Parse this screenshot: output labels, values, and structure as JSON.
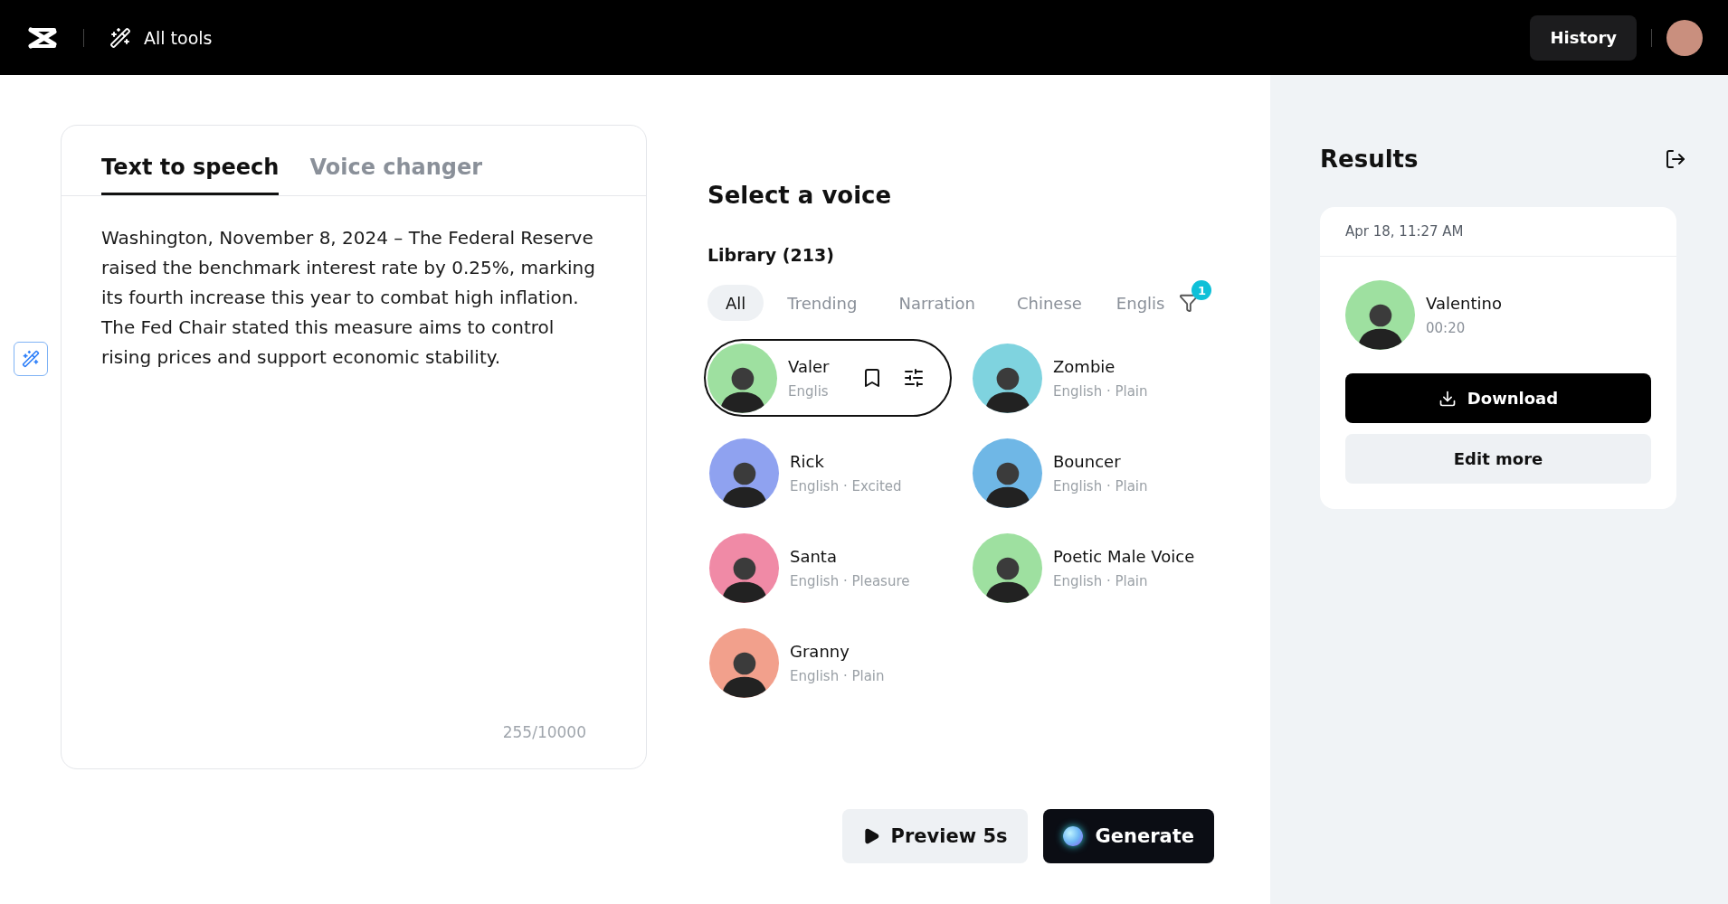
{
  "top_bar": {
    "all_tools": "All tools",
    "history": "History"
  },
  "editor": {
    "tabs": [
      {
        "label": "Text to speech",
        "selected": true
      },
      {
        "label": "Voice changer",
        "selected": false
      }
    ],
    "text": "Washington, November 8, 2024 – The Federal Reserve raised the benchmark interest rate by 0.25%, marking its fourth increase this year to combat high inflation. The Fed Chair stated this measure aims to control rising prices and support economic stability.",
    "counter": "255/10000"
  },
  "voices": {
    "title": "Select a voice",
    "library": "Library (213)",
    "filters": [
      {
        "label": "All",
        "selected": true
      },
      {
        "label": "Trending",
        "selected": false
      },
      {
        "label": "Narration",
        "selected": false
      },
      {
        "label": "Chinese",
        "selected": false
      },
      {
        "label": "Englis",
        "selected": false
      }
    ],
    "filter_badge": "1",
    "items": [
      {
        "name": "Valer",
        "meta": "Englis",
        "selected": true,
        "color": "#9ee0a0"
      },
      {
        "name": "Zombie",
        "meta": "English · Plain",
        "selected": false,
        "color": "#7fd3df"
      },
      {
        "name": "Rick",
        "meta": "English · Excited",
        "selected": false,
        "color": "#8fa2f0"
      },
      {
        "name": "Bouncer",
        "meta": "English · Plain",
        "selected": false,
        "color": "#6fb7e6"
      },
      {
        "name": "Santa",
        "meta": "English · Pleasure",
        "selected": false,
        "color": "#f08aa6"
      },
      {
        "name": "Poetic Male Voice",
        "meta": "English · Plain",
        "selected": false,
        "color": "#9ee0a0"
      },
      {
        "name": "Granny",
        "meta": "English · Plain",
        "selected": false,
        "color": "#f2a08c"
      }
    ],
    "preview": "Preview 5s",
    "generate": "Generate"
  },
  "results": {
    "title": "Results",
    "date": "Apr 18, 11:27 AM",
    "name": "Valentino",
    "duration": "00:20",
    "download": "Download",
    "edit_more": "Edit more"
  }
}
